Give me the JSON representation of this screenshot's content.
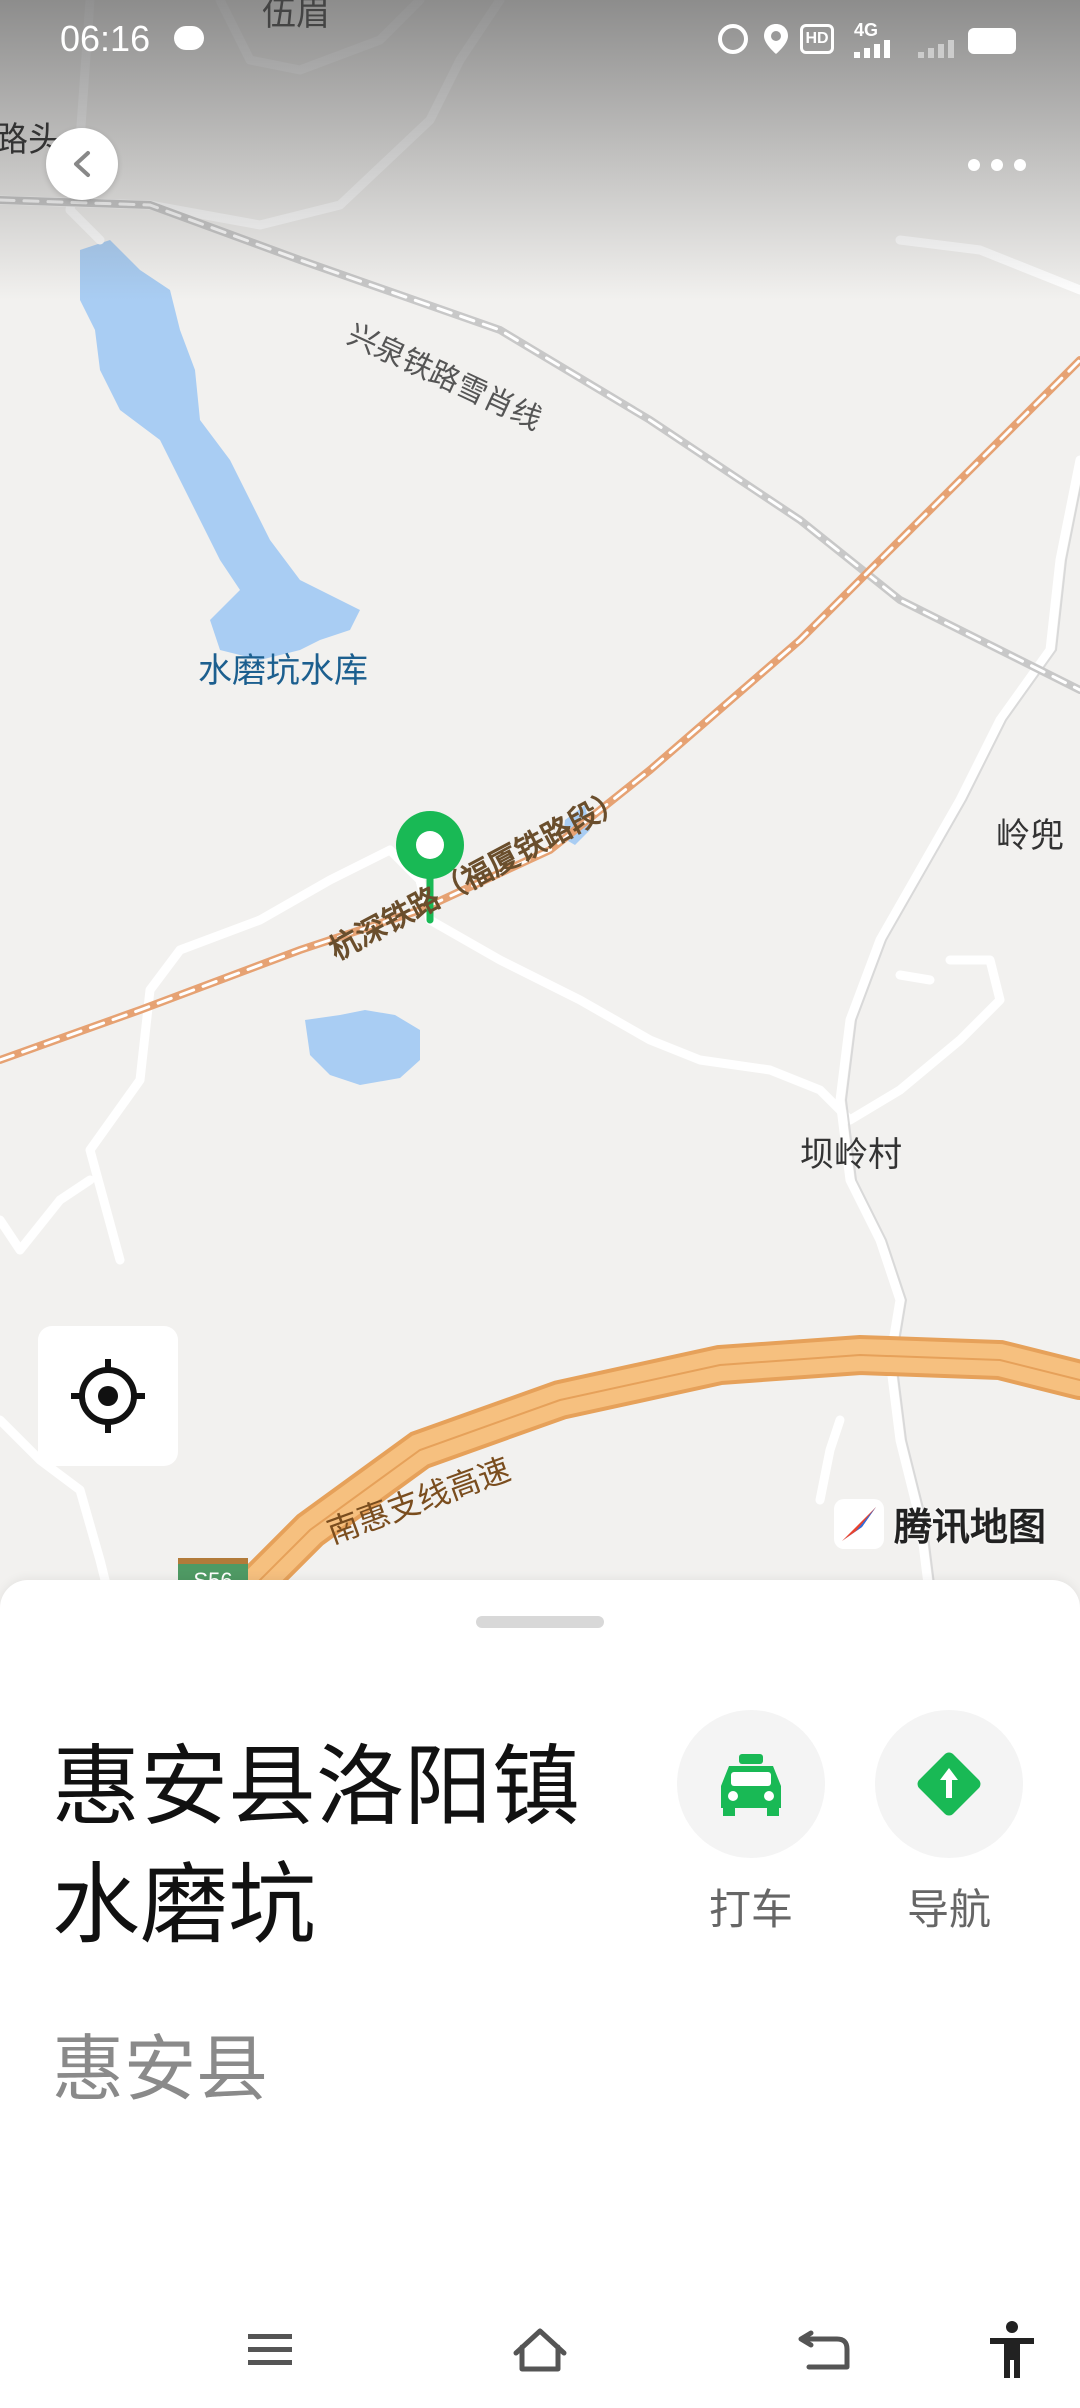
{
  "status_bar": {
    "time": "06:16",
    "network": "4G",
    "hd": "HD"
  },
  "map": {
    "labels": {
      "top_village": "伍眉",
      "left_edge": "路头",
      "railway_top": "兴泉铁路雪肖线",
      "reservoir": "水磨坑水库",
      "railway_main": "杭深铁路（福厦铁路段）",
      "village_right": "岭兜",
      "village_lower": "坝岭村",
      "expressway": "南惠支线高速",
      "shield": "S56"
    },
    "brand": "腾讯地图",
    "colors": {
      "water": "#a9cdf3",
      "railway": "#e6a273",
      "expressway": "#f6c07f",
      "pin": "#19b955",
      "road": "#ffffff"
    }
  },
  "sheet": {
    "title": "惠安县洛阳镇水磨坑",
    "subtitle": "惠安县",
    "actions": [
      {
        "label": "打车",
        "icon": "taxi-icon"
      },
      {
        "label": "导航",
        "icon": "navigate-icon"
      }
    ]
  },
  "nav_bar": {
    "icons": [
      "menu-icon",
      "home-icon",
      "back-icon",
      "accessibility-icon"
    ]
  }
}
